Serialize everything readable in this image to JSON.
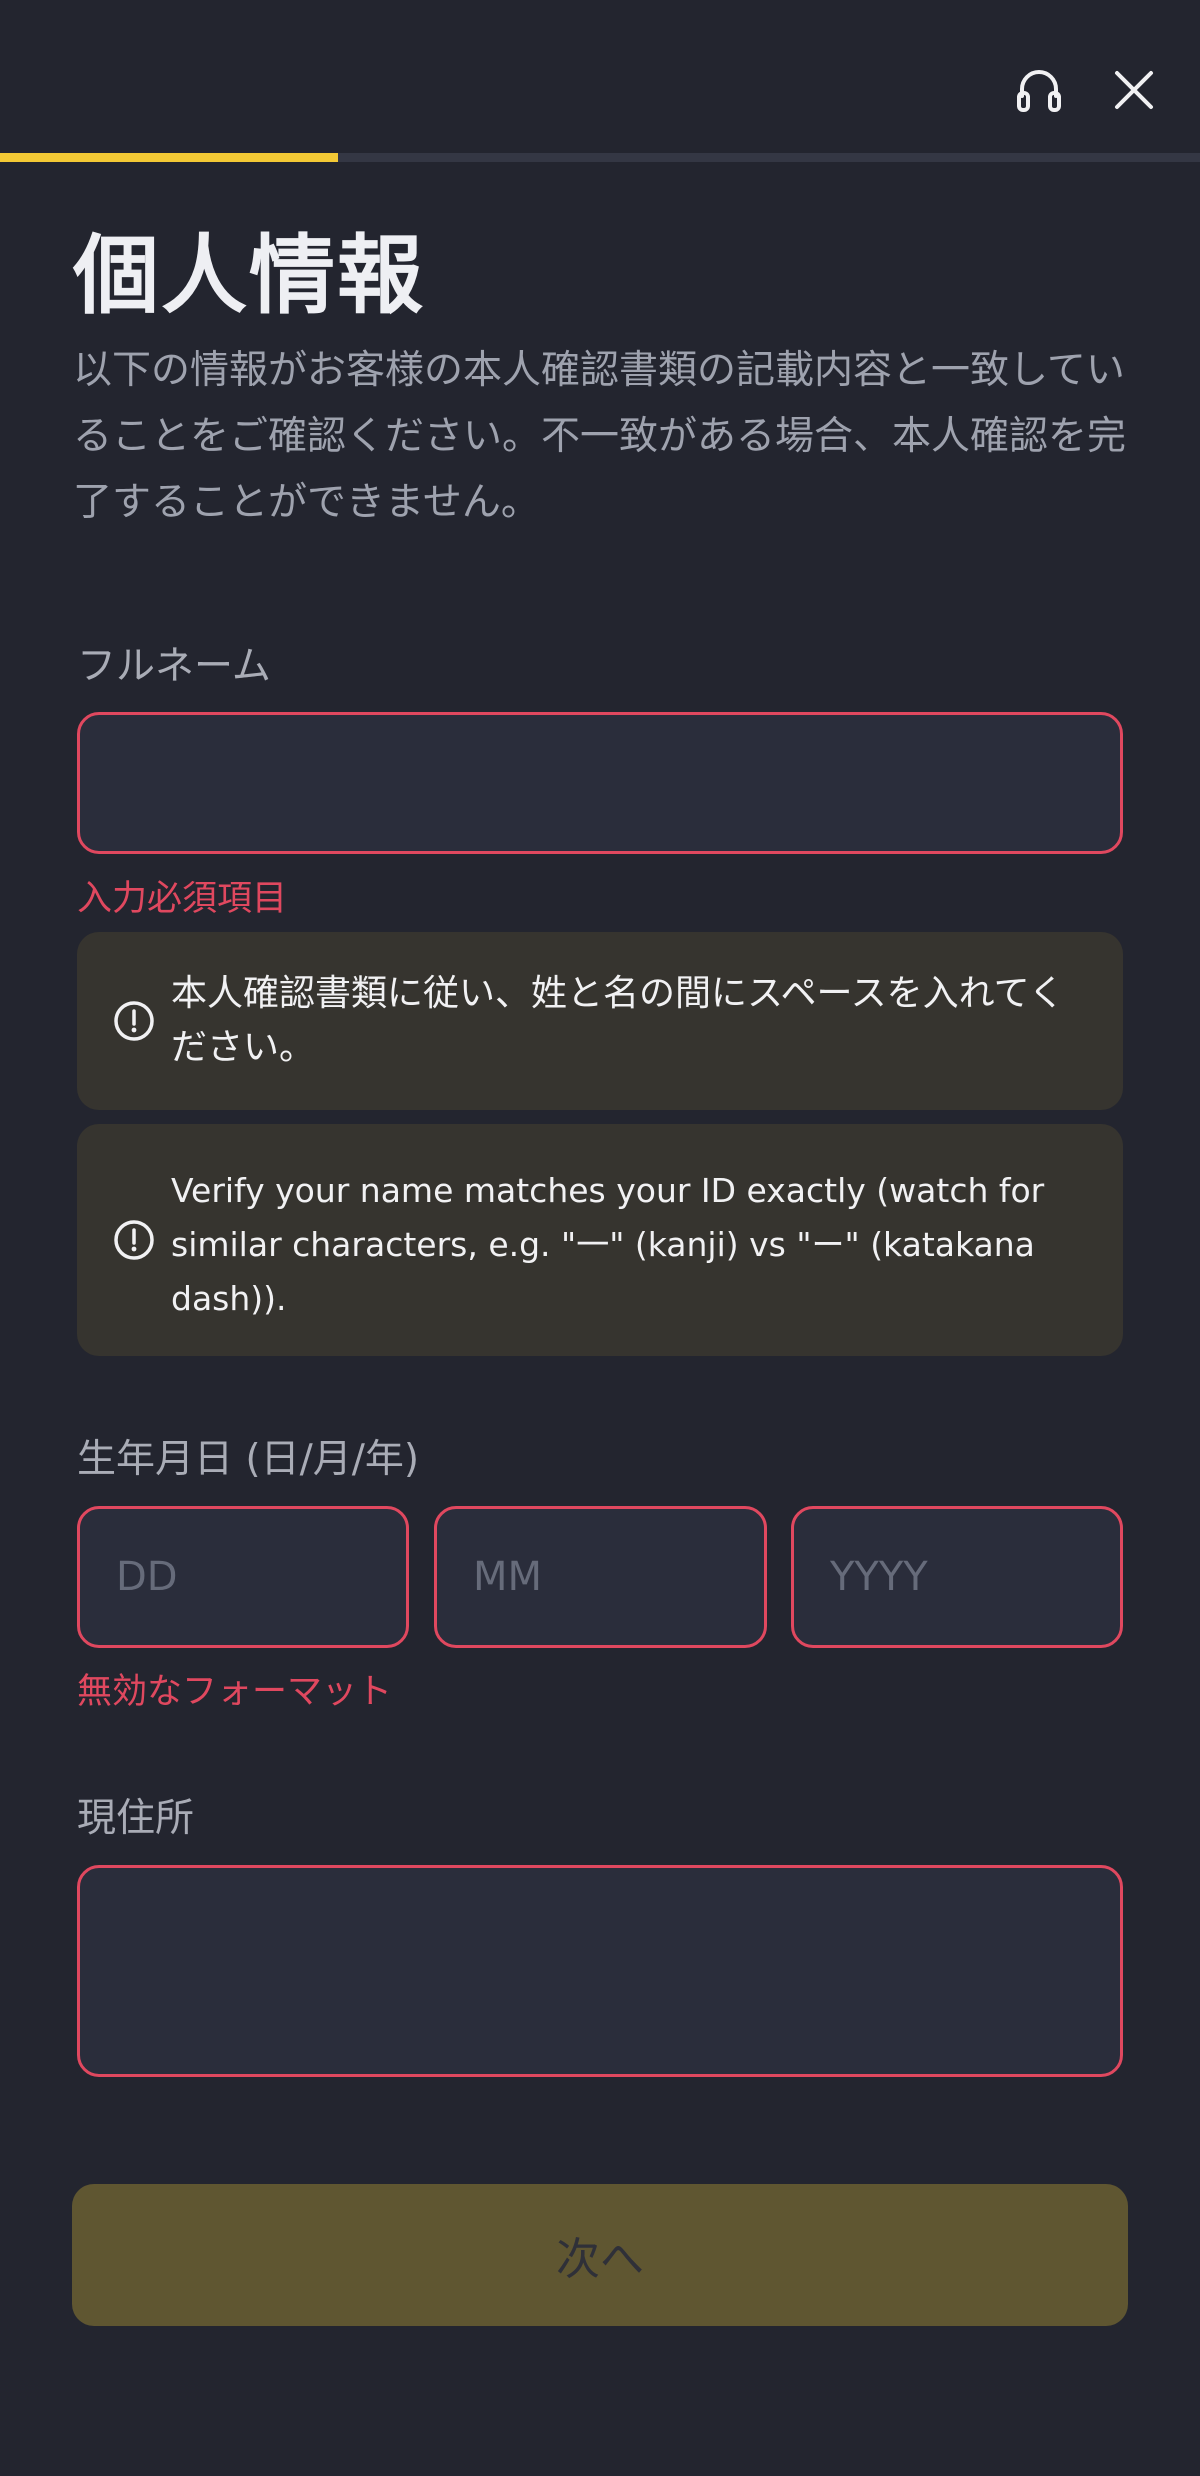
{
  "header": {
    "support_icon": "headset-icon",
    "close_icon": "close-icon",
    "progress_percent": 28.2
  },
  "page": {
    "title": "個人情報",
    "subtitle": "以下の情報がお客様の本人確認書類の記載内容と一致していることをご確認ください。不一致がある場合、本人確認を完了することができません。"
  },
  "full_name": {
    "label": "フルネーム",
    "value": "",
    "placeholder": "",
    "error": "入力必須項目",
    "hint_1": "本人確認書類に従い、姓と名の間にスペースを入れてください。",
    "hint_2": "Verify your name matches your ID exactly (watch for similar characters, e.g. \"一\" (kanji) vs \"ー\" (katakana dash))."
  },
  "dob": {
    "label": "生年月日 (日/月/年)",
    "day_placeholder": "DD",
    "month_placeholder": "MM",
    "year_placeholder": "YYYY",
    "error": "無効なフォーマット"
  },
  "address": {
    "label": "現住所",
    "value": "",
    "placeholder": ""
  },
  "footer": {
    "next_label": "次へ"
  },
  "colors": {
    "background": "#23252f",
    "accent": "#f3c935",
    "error": "#e0485f",
    "info_bg": "#36342f",
    "button_disabled": "#5f5631"
  }
}
